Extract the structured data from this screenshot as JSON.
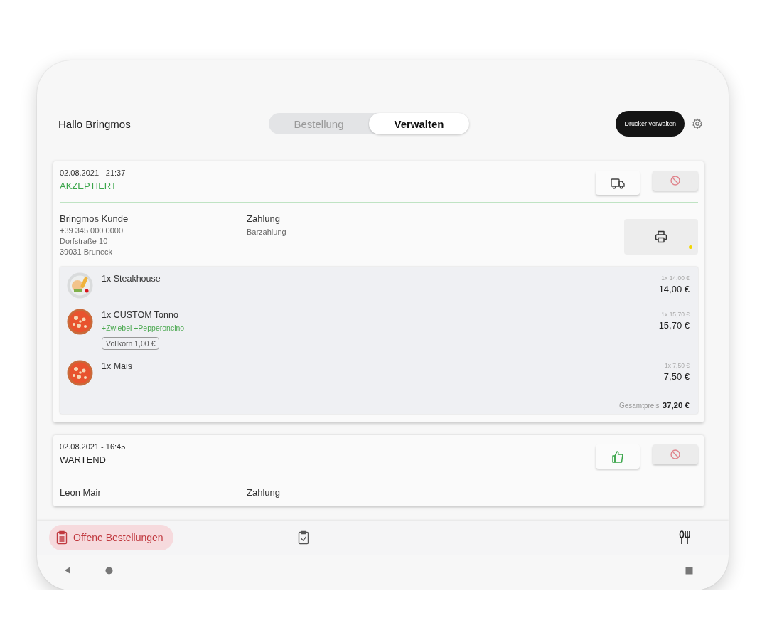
{
  "header": {
    "greeting": "Hallo Bringmos",
    "printer_button": "Drucker verwalten"
  },
  "tabs": [
    {
      "label": "Bestellung",
      "selected": false
    },
    {
      "label": "Verwalten",
      "selected": true
    }
  ],
  "orders": [
    {
      "datetime": "02.08.2021 - 21:37",
      "status": "AKZEPTIERT",
      "kind": "accepted",
      "customer_name": "Bringmos Kunde",
      "customer_lines": [
        "+39 345 000 0000",
        "Dorfstraße 10",
        "39031 Bruneck"
      ],
      "payment_label": "Zahlung",
      "payment_method": "Barzahlung",
      "printer_pending": true,
      "items": [
        {
          "name": "1x Steakhouse",
          "unit_price": "1x 14,00 €",
          "price": "14,00 €"
        },
        {
          "name": "1x CUSTOM Tonno",
          "extras": "+Zwiebel +Pepperoncino",
          "option": "Vollkorn 1,00 €",
          "unit_price": "1x 15,70 €",
          "price": "15,70 €"
        },
        {
          "name": "1x Mais",
          "unit_price": "1x 7,50 €",
          "price": "7,50 €"
        }
      ],
      "total_label": "Gesamtpreis",
      "total": "37,20 €"
    },
    {
      "datetime": "02.08.2021 - 16:45",
      "status": "WARTEND",
      "kind": "waiting",
      "customer_name": "Leon Mair",
      "payment_label": "Zahlung"
    }
  ],
  "bottom_nav": [
    {
      "label": "Offene Bestellungen",
      "selected": true
    },
    {
      "selected": false
    },
    {
      "selected": false
    }
  ]
}
